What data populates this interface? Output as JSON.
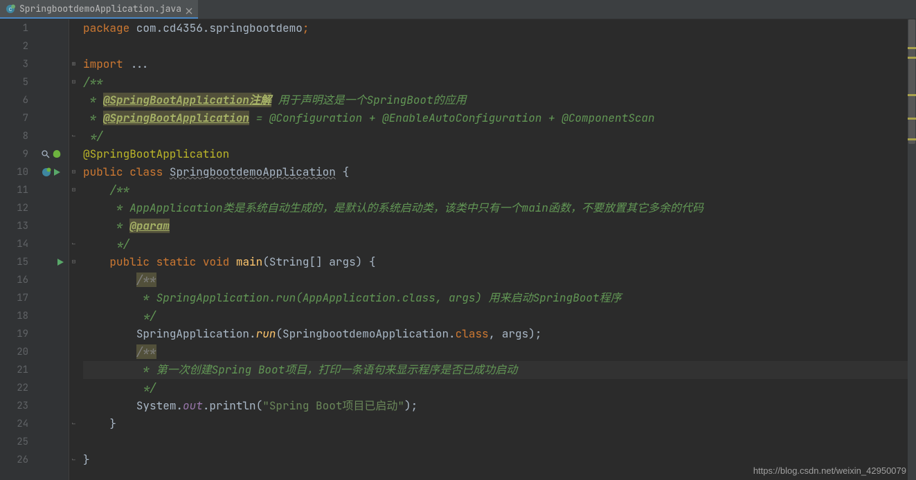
{
  "tab": {
    "filename": "SpringbootdemoApplication.java"
  },
  "lines": [
    "1",
    "2",
    "3",
    "5",
    "6",
    "7",
    "8",
    "9",
    "10",
    "11",
    "12",
    "13",
    "14",
    "15",
    "16",
    "17",
    "18",
    "19",
    "20",
    "21",
    "22",
    "23",
    "24",
    "25",
    "26"
  ],
  "code": {
    "pkg_kw": "package",
    "pkg_name": " com.cd4356.springbootdemo",
    "semi": ";",
    "import_kw": "import",
    "import_dots": " ...",
    "c1_open": "/**",
    "c1_star": " * ",
    "c1_ann1": "@SpringBootApplication",
    "c1_zhujie": "注解",
    "c1_desc1": " 用于声明这是一个SpringBoot的应用",
    "c1_ann2": "@SpringBootApplication",
    "c1_eq": " = @Configuration + @EnableAutoConfiguration + @ComponentScan",
    "c_close": " */",
    "ann": "@SpringBootApplication",
    "pub": "public",
    "cls": "class",
    "clsname": "SpringbootdemoApplication",
    "brace_o": " {",
    "c2_open": "/**",
    "c2_l1": " * AppApplication类是系统自动生成的，是默认的系统启动类，该类中只有一个main函数，不要放置其它多余的代码",
    "c2_param_pre": " * ",
    "c2_param": "@param",
    "static_kw": "static",
    "void_kw": "void",
    "main": "main",
    "main_args": "(String[] args) {",
    "c3_open": "/**",
    "c3_l1": " * SpringApplication.run(AppApplication.class, args) 用来启动SpringBoot程序",
    "run_call_pre": "SpringApplication.",
    "run_fn": "run",
    "run_open": "(SpringbootdemoApplication.",
    "class_kw": "class",
    "run_close": ", args);",
    "c4_open": "/**",
    "c4_l1": " * 第一次创建Spring Boot项目，打印一条语句来显示程序是否已成功启动",
    "sys": "System.",
    "out": "out",
    "println": ".println(",
    "str": "\"Spring Boot项目已启动\"",
    "println_close": ");",
    "brace_c": "}"
  },
  "watermark": "https://blog.csdn.net/weixin_42950079"
}
